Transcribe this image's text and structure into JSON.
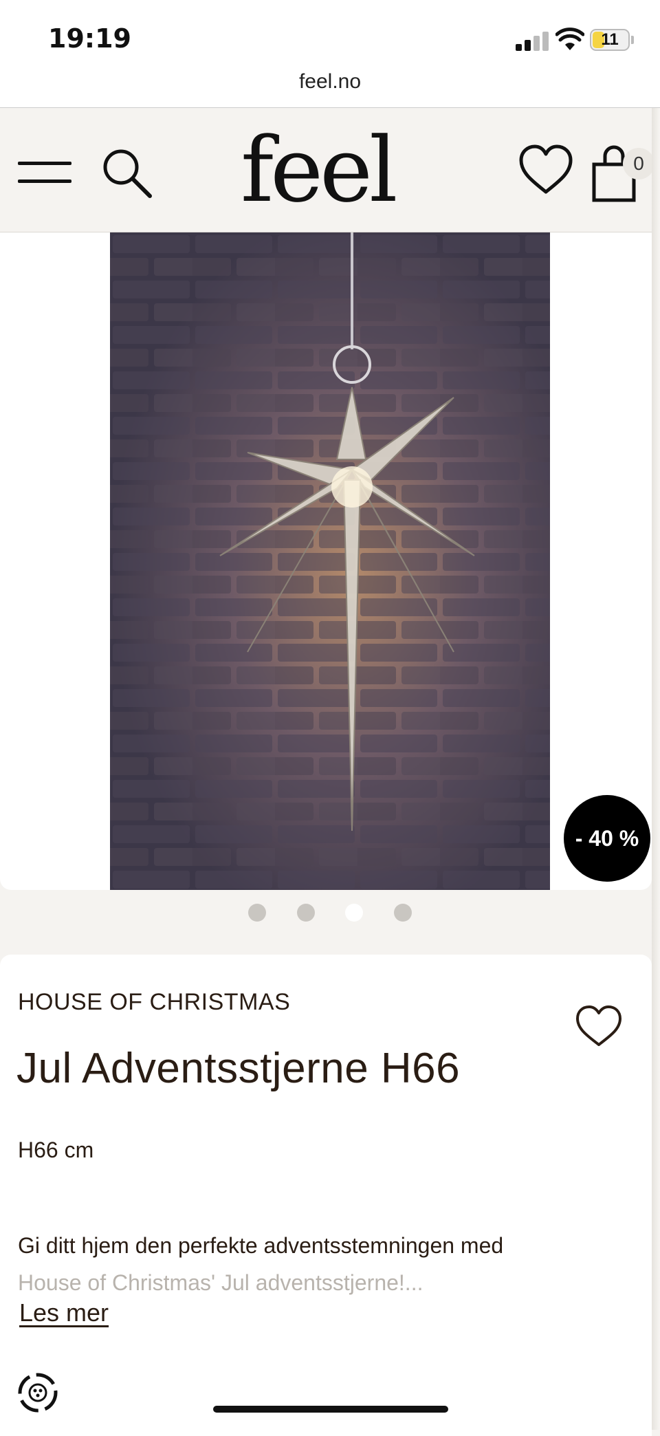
{
  "status_bar": {
    "time": "19:19",
    "battery_level": "11"
  },
  "browser": {
    "url": "feel.no"
  },
  "header": {
    "logo": "feel",
    "cart_count": "0",
    "icons": [
      "menu-icon",
      "search-icon",
      "heart-icon",
      "shopping-bag-icon"
    ]
  },
  "gallery": {
    "discount_badge": "- 40 %",
    "dot_count": 4,
    "active_dot": 3
  },
  "product": {
    "brand": "HOUSE OF CHRISTMAS",
    "title": "Jul Adventsstjerne H66",
    "dimension": "H66 cm",
    "description_line1": "Gi ditt hjem den perfekte adventsstemningen med",
    "description_line2": "House of Christmas' Jul adventsstjerne!...",
    "read_more": "Les mer"
  },
  "colors": {
    "accent_text": "#2a1d14",
    "background": "#f5f3f0",
    "badge": "#000000"
  }
}
